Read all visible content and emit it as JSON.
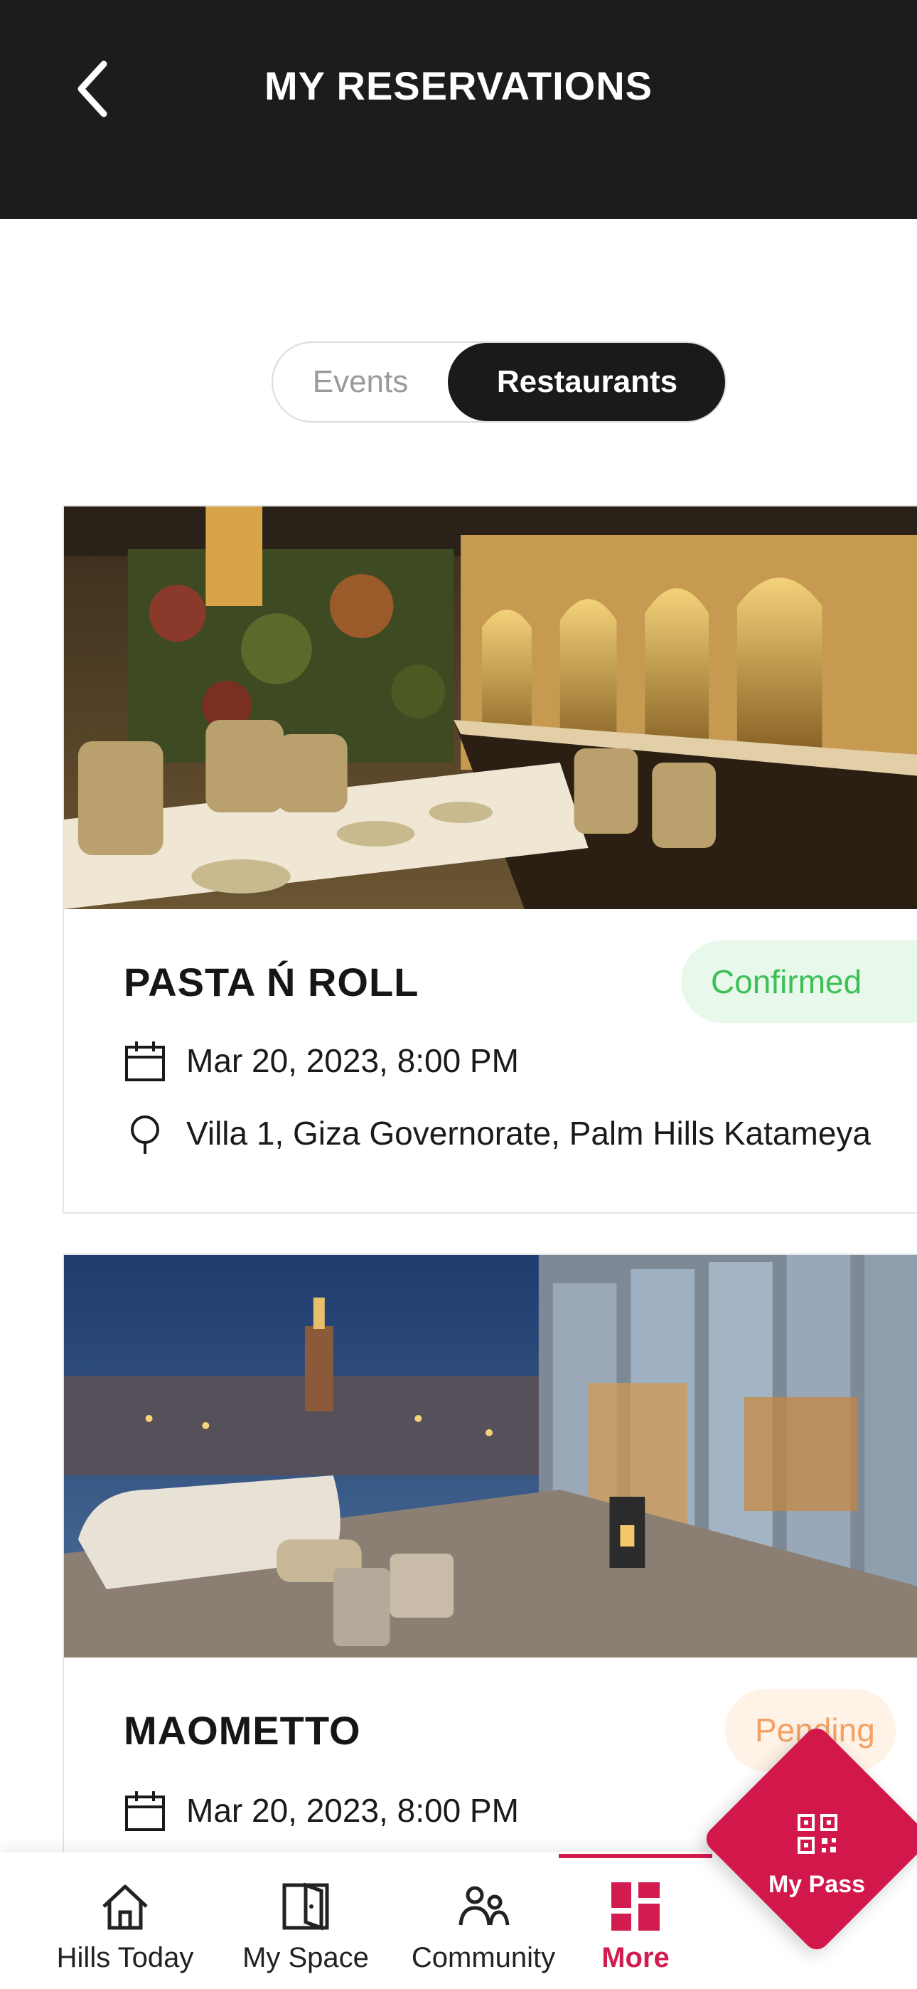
{
  "header": {
    "title": "MY RESERVATIONS",
    "back_icon": "chevron-left-icon"
  },
  "tabs": {
    "events": "Events",
    "restaurants": "Restaurants",
    "active": "restaurants"
  },
  "reservations": [
    {
      "name": "PASTA Ń ROLL",
      "status": "Confirmed",
      "datetime": "Mar 20, 2023, 8:00 PM",
      "location": "Villa 1, Giza Governorate, Palm Hills Katameya",
      "image": "restaurant-interior-photo"
    },
    {
      "name": "MAOMETTO",
      "status": "Pending",
      "datetime": "Mar 20, 2023, 8:00 PM",
      "image": "rooftop-terrace-photo"
    }
  ],
  "nav": [
    {
      "label": "Hills Today",
      "icon": "home-icon"
    },
    {
      "label": "My Space",
      "icon": "door-icon"
    },
    {
      "label": "Community",
      "icon": "people-icon"
    },
    {
      "label": "More",
      "icon": "grid-icon",
      "active": true
    }
  ],
  "my_pass": {
    "label": "My Pass",
    "icon": "qr-code-icon"
  },
  "colors": {
    "accent": "#d21c4f",
    "header_bg": "#1c1c1c",
    "confirmed": "#3cbf55",
    "pending": "#f2a264"
  }
}
